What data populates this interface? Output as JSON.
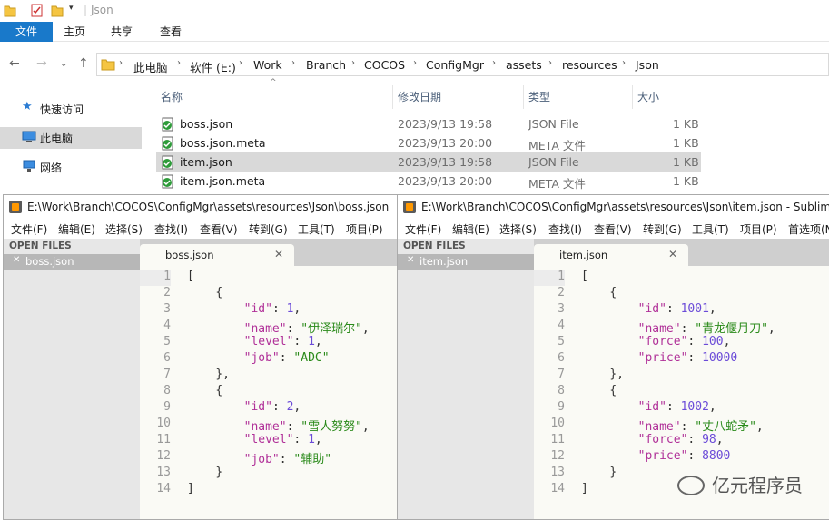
{
  "explorer": {
    "window_title": "Json",
    "ribbon_tabs": [
      "文件",
      "主页",
      "共享",
      "查看"
    ],
    "breadcrumbs": [
      "此电脑",
      "软件 (E:)",
      "Work",
      "Branch",
      "COCOS",
      "ConfigMgr",
      "assets",
      "resources",
      "Json"
    ],
    "nav": [
      {
        "label": "快速访问",
        "icon": "star-icon"
      },
      {
        "label": "此电脑",
        "icon": "computer-icon"
      },
      {
        "label": "网络",
        "icon": "network-icon"
      }
    ],
    "columns": {
      "name": "名称",
      "date": "修改日期",
      "type": "类型",
      "size": "大小"
    },
    "files": [
      {
        "name": "boss.json",
        "date": "2023/9/13 19:58",
        "type": "JSON File",
        "size": "1 KB"
      },
      {
        "name": "boss.json.meta",
        "date": "2023/9/13 20:00",
        "type": "META 文件",
        "size": "1 KB"
      },
      {
        "name": "item.json",
        "date": "2023/9/13 19:58",
        "type": "JSON File",
        "size": "1 KB"
      },
      {
        "name": "item.json.meta",
        "date": "2023/9/13 20:00",
        "type": "META 文件",
        "size": "1 KB"
      }
    ]
  },
  "sublime_left": {
    "title": "E:\\Work\\Branch\\COCOS\\ConfigMgr\\assets\\resources\\Json\\boss.json",
    "menu": [
      "文件(F)",
      "编辑(E)",
      "选择(S)",
      "查找(I)",
      "查看(V)",
      "转到(G)",
      "工具(T)",
      "项目(P)"
    ],
    "open_files_label": "OPEN FILES",
    "sidebar_file": "boss.json",
    "tab": "boss.json",
    "lines": [
      "[",
      "    {",
      "        \"id\": 1,",
      "        \"name\": \"伊泽瑞尔\",",
      "        \"level\": 1,",
      "        \"job\": \"ADC\"",
      "    },",
      "    {",
      "        \"id\": 2,",
      "        \"name\": \"雪人努努\",",
      "        \"level\": 1,",
      "        \"job\": \"辅助\"",
      "    }",
      "]"
    ]
  },
  "sublime_right": {
    "title": "E:\\Work\\Branch\\COCOS\\ConfigMgr\\assets\\resources\\Json\\item.json - Sublim",
    "menu": [
      "文件(F)",
      "编辑(E)",
      "选择(S)",
      "查找(I)",
      "查看(V)",
      "转到(G)",
      "工具(T)",
      "项目(P)",
      "首选项(N"
    ],
    "open_files_label": "OPEN FILES",
    "sidebar_file": "item.json",
    "tab": "item.json",
    "lines": [
      "[",
      "    {",
      "        \"id\": 1001,",
      "        \"name\": \"青龙偃月刀\",",
      "        \"force\": 100,",
      "        \"price\": 10000",
      "    },",
      "    {",
      "        \"id\": 1002,",
      "        \"name\": \"丈八蛇矛\",",
      "        \"force\": 98,",
      "        \"price\": 8800",
      "    }",
      "]"
    ]
  },
  "watermark": "亿元程序员"
}
